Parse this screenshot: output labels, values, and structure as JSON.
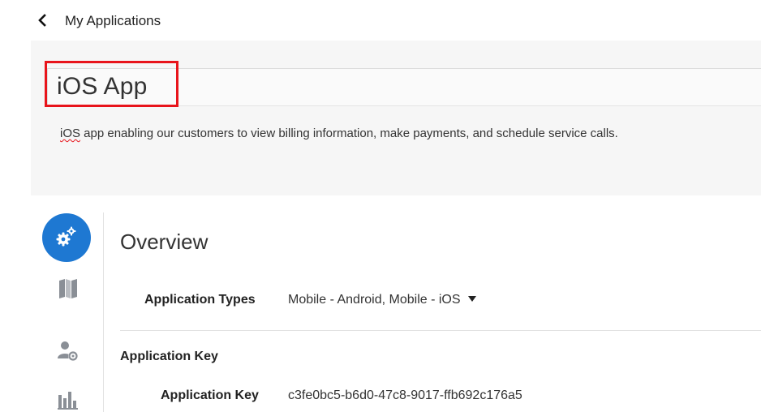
{
  "nav": {
    "back_label": "My Applications"
  },
  "app": {
    "title": "iOS App",
    "description_first_word": "iOS",
    "description_rest": " app enabling our customers to view billing information, make payments, and schedule service calls."
  },
  "sidebar": {
    "items": [
      {
        "icon": "gears-icon",
        "active": true
      },
      {
        "icon": "map-icon"
      },
      {
        "icon": "user-settings-icon"
      },
      {
        "icon": "bar-chart-icon"
      }
    ]
  },
  "overview": {
    "title": "Overview",
    "application_types_label": "Application Types",
    "application_types_value": "Mobile - Android, Mobile - iOS",
    "application_key_section": "Application Key",
    "application_key_label": "Application Key",
    "application_key_value": "c3fe0bc5-b6d0-47c8-9017-ffb692c176a5"
  },
  "colors": {
    "accent": "#1e78d2",
    "highlight": "#e8141b",
    "icon_gray": "#8a8f96"
  }
}
